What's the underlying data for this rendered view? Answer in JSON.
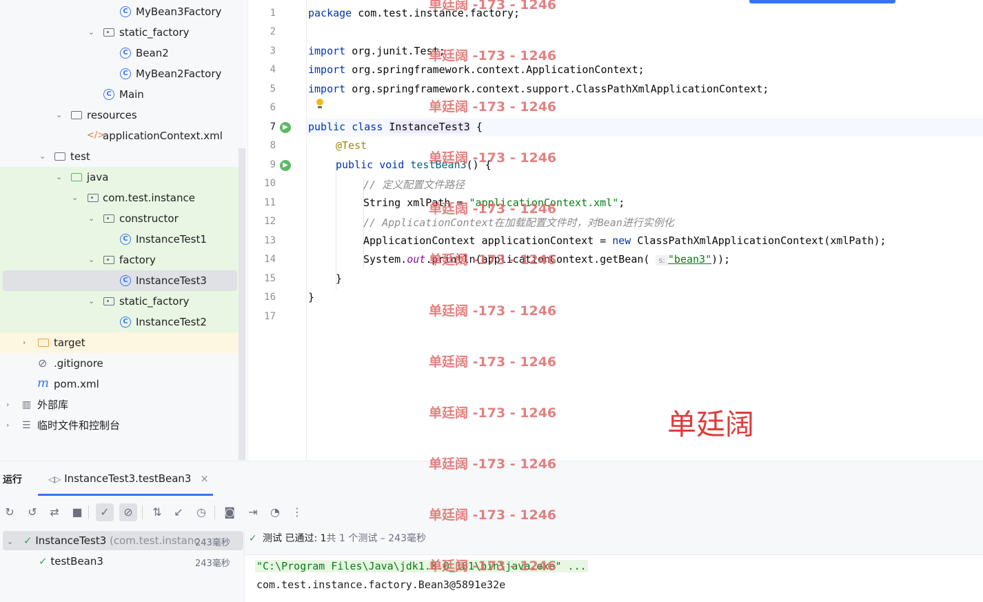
{
  "tree": {
    "items": [
      {
        "label": "MyBean3Factory",
        "icon": "class-icon"
      },
      {
        "label": "static_factory",
        "icon": "package-icon"
      },
      {
        "label": "Bean2",
        "icon": "class-icon"
      },
      {
        "label": "MyBean2Factory",
        "icon": "class-icon"
      },
      {
        "label": "Main",
        "icon": "main-class-icon"
      },
      {
        "label": "resources",
        "icon": "resources-folder-icon"
      },
      {
        "label": "applicationContext.xml",
        "icon": "xml-file-icon"
      },
      {
        "label": "test",
        "icon": "folder-icon"
      },
      {
        "label": "java",
        "icon": "test-folder-icon"
      },
      {
        "label": "com.test.instance",
        "icon": "package-icon"
      },
      {
        "label": "constructor",
        "icon": "package-icon"
      },
      {
        "label": "InstanceTest1",
        "icon": "test-class-icon"
      },
      {
        "label": "factory",
        "icon": "package-icon"
      },
      {
        "label": "InstanceTest3",
        "icon": "test-class-icon"
      },
      {
        "label": "static_factory",
        "icon": "package-icon"
      },
      {
        "label": "InstanceTest2",
        "icon": "test-class-icon"
      },
      {
        "label": "target",
        "icon": "excluded-folder-icon"
      },
      {
        "label": ".gitignore",
        "icon": "ignore-file-icon"
      },
      {
        "label": "pom.xml",
        "icon": "maven-icon"
      },
      {
        "label": "外部库",
        "icon": "library-icon"
      },
      {
        "label": "临时文件和控制台",
        "icon": "scratches-icon"
      }
    ]
  },
  "editor": {
    "line_numbers": [
      "1",
      "2",
      "3",
      "4",
      "5",
      "6",
      "7",
      "8",
      "9",
      "10",
      "11",
      "12",
      "13",
      "14",
      "15",
      "16",
      "17"
    ],
    "code": {
      "l1_kw": "package",
      "l1_rest": " com.test.instance.factory;",
      "l3_kw": "import",
      "l3_rest": " org.junit.Test;",
      "l4_kw": "import",
      "l4_rest": " org.springframework.context.ApplicationContext;",
      "l5_kw": "import",
      "l5_rest": " org.springframework.context.support.ClassPathXmlApplicationContext;",
      "l7_kw": "public class",
      "l7_name": "InstanceTest3",
      "l7_rest": " {",
      "l8_ann": "@Test",
      "l9_kw": "public void",
      "l9_name": "testBean3",
      "l9_rest": "() {",
      "l10_cmt": "// 定义配置文件路径",
      "l11_a": "String xmlPath = ",
      "l11_str": "\"applicationContext.xml\"",
      "l11_b": ";",
      "l12_cmt": "// ApplicationContext在加载配置文件时，对Bean进行实例化",
      "l13_a": "ApplicationContext applicationContext = ",
      "l13_kw": "new",
      "l13_b": " ClassPathXmlApplicationContext(xmlPath);",
      "l14_a": "System.",
      "l14_fld": "out",
      "l14_b": ".println(applicationContext.getBean(",
      "l14_hint": "s:",
      "l14_str": "\"bean3\"",
      "l14_c": "));",
      "l15": "}",
      "l16": "}"
    }
  },
  "watermark": {
    "text": "单廷阔 -173 - 1246",
    "big": "单廷阔"
  },
  "run": {
    "title": "运行",
    "tab_label": "InstanceTest3.testBean3",
    "tab_close": "×",
    "tests": [
      {
        "label": "InstanceTest3",
        "sub": "(com.test.instanc",
        "duration": "243毫秒"
      },
      {
        "label": "testBean3",
        "duration": "243毫秒"
      }
    ],
    "status": {
      "prefix": "测试 已通过: ",
      "passed": "1",
      "rest": "共 1 个测试 – 243毫秒"
    },
    "console": [
      "\"C:\\Program Files\\Java\\jdk1.8.0_181\\bin\\java.exe\" ...",
      "com.test.instance.factory.Bean3@5891e32e"
    ]
  }
}
